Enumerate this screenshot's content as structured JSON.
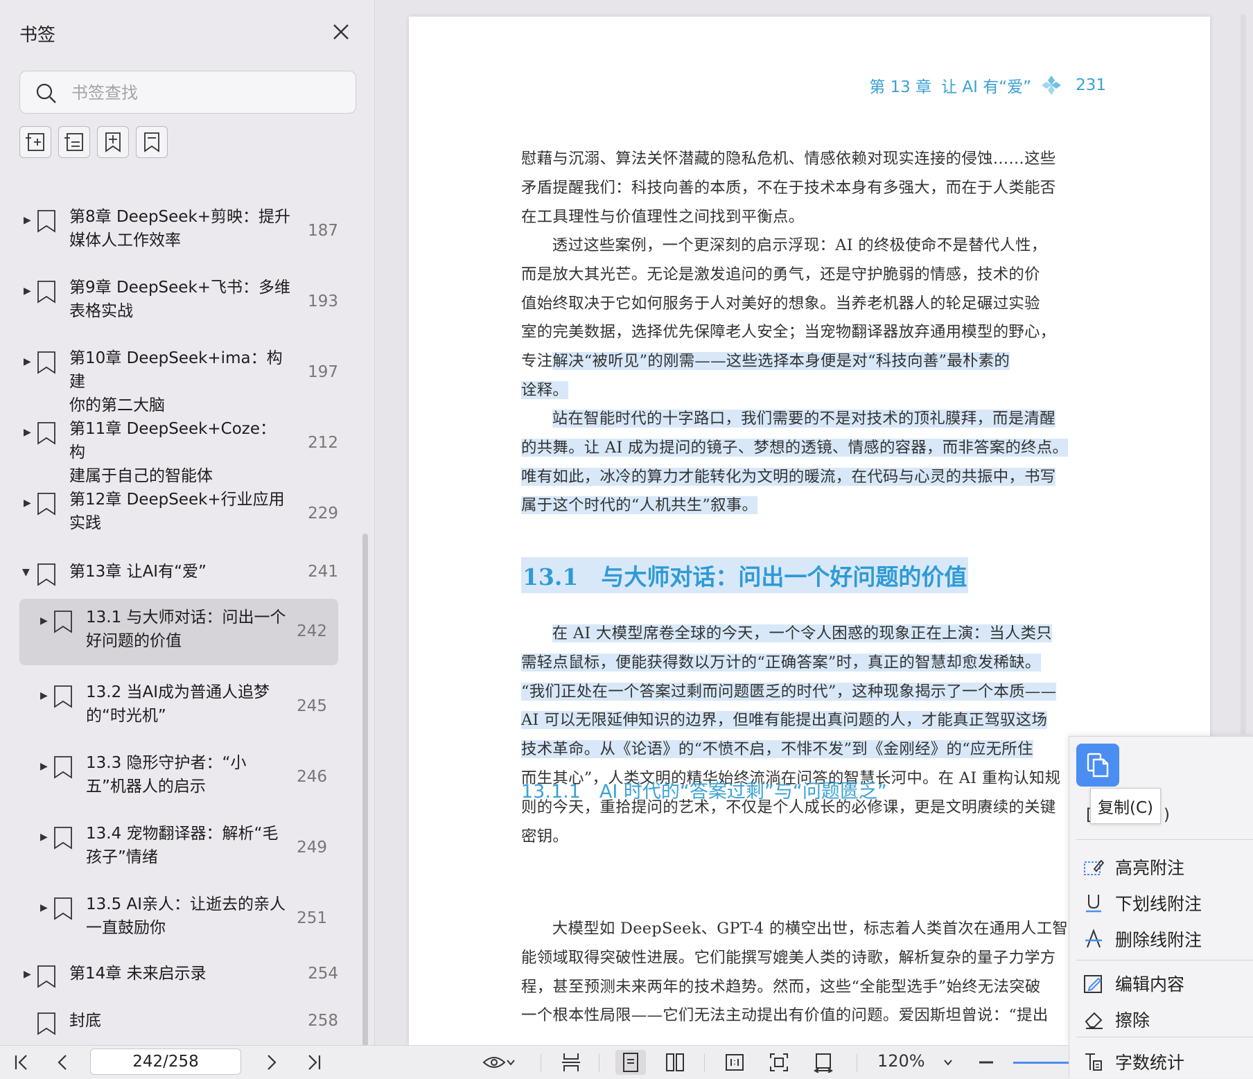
{
  "sidebar": {
    "title": "书签",
    "search_placeholder": "书签查找",
    "items": [
      {
        "line1": "第8章 DeepSeek+剪映：提升",
        "line2": "媒体人工作效率",
        "page": "187",
        "expanded": false
      },
      {
        "line1": "第9章 DeepSeek+飞书：多维",
        "line2": "表格实战",
        "page": "193",
        "expanded": false
      },
      {
        "line1": "第10章 DeepSeek+ima：构建",
        "line2": "你的第二大脑",
        "page": "197",
        "expanded": false
      },
      {
        "line1": "第11章 DeepSeek+Coze：构",
        "line2": "建属于自己的智能体",
        "page": "212",
        "expanded": false
      },
      {
        "line1": "第12章 DeepSeek+行业应用",
        "line2": "实践",
        "page": "229",
        "expanded": false
      },
      {
        "line1": "第13章 让AI有“爱”",
        "line2": "",
        "page": "241",
        "expanded": true
      },
      {
        "line1": "13.1 与大师对话：问出一个",
        "line2": "好问题的价值",
        "page": "242",
        "selected": true
      },
      {
        "line1": "13.2 当AI成为普通人追梦",
        "line2": "的“时光机”",
        "page": "245"
      },
      {
        "line1": "13.3 隐形守护者：“小",
        "line2": "五”机器人的启示",
        "page": "246"
      },
      {
        "line1": "13.4 宠物翻译器：解析“毛",
        "line2": "孩子”情绪",
        "page": "249"
      },
      {
        "line1": "13.5 AI亲人：让逝去的亲人",
        "line2": "一直鼓励你",
        "page": "251"
      },
      {
        "line1": "第14章 未来启示录",
        "line2": "",
        "page": "254",
        "expanded": false
      },
      {
        "line1": "封底",
        "line2": "",
        "page": "258"
      }
    ]
  },
  "document": {
    "header_chapter": "第 13 章",
    "header_title": "让 AI 有“爱”",
    "header_page": "231",
    "p1": [
      "慰藉与沉溺、算法关怀潜藏的隐私危机、情感依赖对现实连接的侵蚀……这些",
      "矛盾提醒我们：科技向善的本质，不在于技术本身有多强大，而在于人类能否",
      "在工具理性与价值理性之间找到平衡点。"
    ],
    "p2": [
      "透过这些案例，一个更深刻的启示浮现：AI 的终极使命不是替代人性，",
      "而是放大其光芒。无论是激发追问的勇气，还是守护脆弱的情感，技术的价",
      "值始终取决于它如何服务于人对美好的想象。当养老机器人的轮足碾过实验",
      "室的完美数据，选择优先保障老人安全；当宠物翻译器放弃通用模型的野心，"
    ],
    "p2_line5_pre": "专注",
    "p2_line5_hl": "解决“被听见”的刚需——这些选择本身便是对“科技向善”最朴素的",
    "p2_line6_hl": "诠释。",
    "p3_hl": [
      "站在智能时代的十字路口，我们需要的不是对技术的顶礼膜拜，而是清醒",
      "的共舞。让 AI 成为提问的镜子、梦想的透镜、情感的容器，而非答案的终点。",
      "唯有如此，冰冷的算力才能转化为文明的暖流，在代码与心灵的共振中，书写",
      "属于这个时代的“人机共生”叙事。"
    ],
    "h2": "13.1　与大师对话：问出一个好问题的价值",
    "p4_hl": [
      "在 AI 大模型席卷全球的今天，一个令人困惑的现象正在上演：当人类只",
      "需轻点鼠标，便能获得数以万计的“正确答案”时，真正的智慧却愈发稀缺。",
      "“我们正处在一个答案过剩而问题匮乏的时代”，这种现象揭示了一个本质——",
      "AI 可以无限延伸知识的边界，但唯有能提出真问题的人，才能真正驾驭这场",
      "技术革命。从《论语》的“不愤不启，不悱不发”到《金刚经》的“应无所住"
    ],
    "p4_rest": [
      "而生其心”，人类文明的精华始终流淌在问答的智慧长河中。在 AI 重构认知规",
      "则的今天，重拾提问的艺术，不仅是个人成长的必修课，更是文明赓续的关键",
      "密钥。"
    ],
    "h3": "13.1.1　AI 时代的“答案过剩”与“问题匮乏”",
    "p5": [
      "大模型如 DeepSeek、GPT-4 的横空出世，标志着人类首次在通用人工智",
      "能领域取得突破性进展。它们能撰写媲美人类的诗歌，解析复杂的量子力学方",
      "程，甚至预测未来两年的技术趋势。然而，这些“全能型选手”始终无法突破",
      "一个根本性局限——它们无法主动提出有价值的问题。爱因斯坦曾说：“提出"
    ]
  },
  "context_menu": {
    "copy_tooltip": "复制(C)",
    "behind_left": "[",
    "behind_right": ")",
    "items": [
      "高亮附注",
      "下划线附注",
      "删除线附注",
      "编辑内容",
      "擦除",
      "字数统计"
    ]
  },
  "bottom": {
    "page_indicator": "242/258",
    "zoom": "120%"
  }
}
